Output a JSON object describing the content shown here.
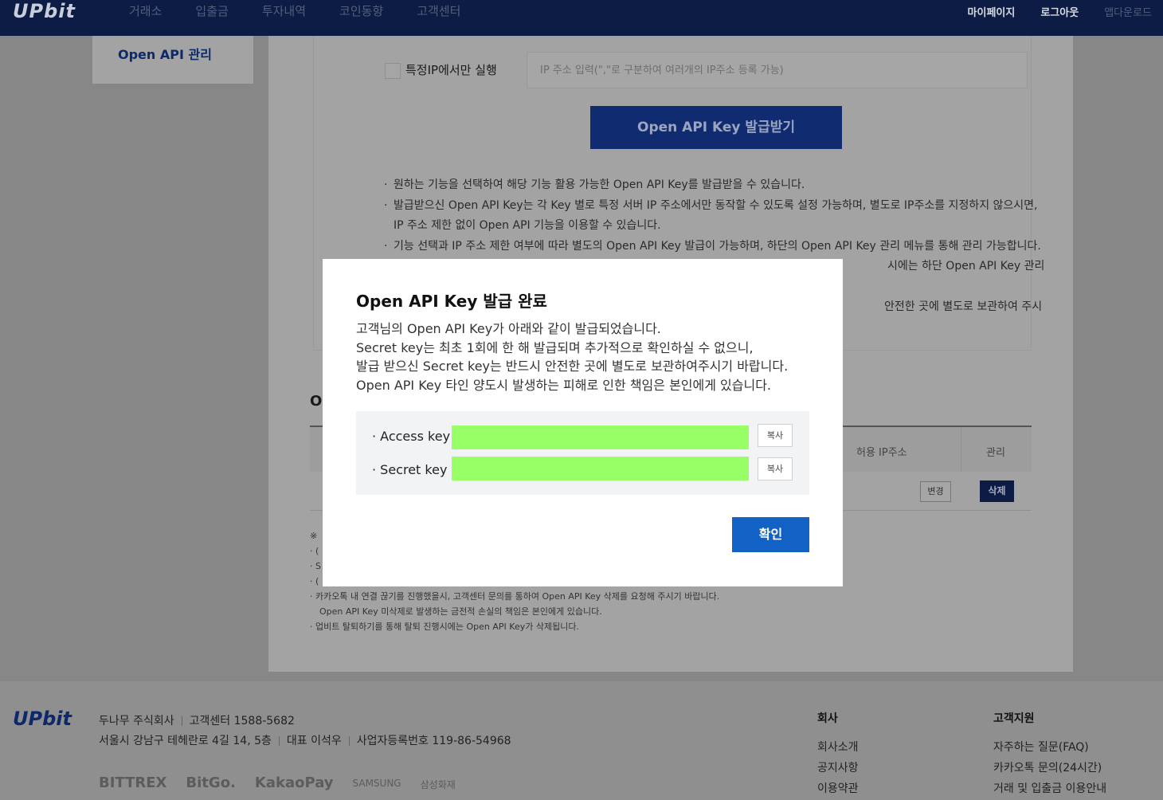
{
  "header": {
    "logo": "UPbit",
    "nav": [
      "거래소",
      "입출금",
      "투자내역",
      "코인동향",
      "고객센터"
    ],
    "mypage": "마이페이지",
    "logout": "로그아웃",
    "app_download": "앱다운로드"
  },
  "side": {
    "item": "Open API 관리"
  },
  "form": {
    "ip_only_label": "특정IP에서만 실행",
    "ip_placeholder": "IP 주소 입력(\",\"로 구분하여 여러개의 IP주소 등록 가능)",
    "issue_button": "Open API Key 발급받기",
    "notes": [
      "원하는 기능을 선택하여 해당 기능 활용 가능한 Open API Key를 발급받을 수 있습니다.",
      "발급받으신 Open API Key는 각 Key 별로 특정 서버 IP 주소에서만 동작할 수 있도록 설정 가능하며, 별도로 IP주소를 지정하지 않으시면,",
      "IP 주소 제한 없이 Open API 기능을 이용할 수 있습니다.",
      "기능 선택과 IP 주소 제한 여부에 따라 별도의 Open API Key 발급이 가능하며, 하단의 Open API Key 관리 메뉴를 통해 관리 가능합니다.",
      "시에는 하단 Open API Key 관리",
      "안전한 곳에 별도로 보관하여 주시"
    ]
  },
  "list": {
    "title": "O",
    "col_ip": "허용 IP주소",
    "col_manage": "관리",
    "btn_change": "변경",
    "btn_delete": "삭제",
    "foot_notes": [
      "※",
      "· (",
      "· S",
      "· (",
      "· 카카오톡 내 연결 끊기를 진행했을시, 고객센터 문의를 통하여 Open API Key 삭제를 요청해 주시기 바랍니다.",
      "Open API Key 미삭제로 발생하는 금전적 손실의 책임은 본인에게 있습니다.",
      "· 업비트 탈퇴하기를 통해 탈퇴 진행시에는 Open API Key가 삭제됩니다."
    ]
  },
  "modal": {
    "title": "Open API Key 발급 완료",
    "desc": [
      "고객님의 Open API Key가 아래와 같이 발급되었습니다.",
      "Secret key는 최초 1회에 한 해 발급되며 추가적으로 확인하실 수 없으니,",
      "발급 받으신 Secret key는 반드시 안전한 곳에 별도로 보관하여주시기 바랍니다.",
      "Open API Key 타인 양도시 발생하는 피해로 인한 책임은 본인에게 있습니다."
    ],
    "access_label": "· Access key",
    "secret_label": "· Secret key",
    "copy": "복사",
    "confirm": "확인",
    "redact_color": "#99ff66"
  },
  "footer": {
    "logo": "UPbit",
    "company": "두나무 주식회사",
    "cs": "고객센터 1588-5682",
    "address": "서울시 강남구 테헤란로 4길 14, 5층",
    "ceo": "대표 이석우",
    "biz": "사업자등록번호 119-86-54968",
    "partners": [
      "BITTREX",
      "BitGo.",
      "KakaoPay",
      "SAMSUNG",
      "삼성화재"
    ],
    "col1_title": "회사",
    "col1": [
      "회사소개",
      "공지사항",
      "이용약관"
    ],
    "col2_title": "고객지원",
    "col2": [
      "자주하는 질문(FAQ)",
      "카카오톡 문의(24시간)",
      "거래 및 입출금 이용안내"
    ]
  }
}
